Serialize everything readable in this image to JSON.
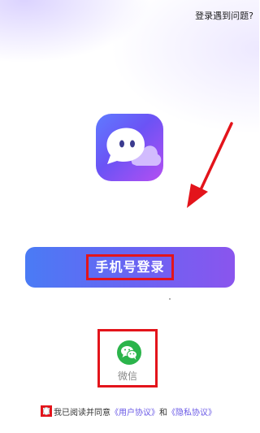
{
  "header": {
    "help_label": "登录遇到问题?"
  },
  "app": {
    "icon": "chat-bubble-app-icon"
  },
  "login": {
    "phone_label": "手机号登录"
  },
  "wechat": {
    "label": "微信",
    "icon": "wechat-icon"
  },
  "agreement": {
    "prefix": "我已阅读并同意",
    "user_agreement": "《用户协议》",
    "conjunction": "和",
    "privacy_policy": "《隐私协议》"
  },
  "colors": {
    "accent_blue": "#4a7bf5",
    "accent_purple": "#8a55ee",
    "wechat_green": "#2bb44b",
    "annotation_red": "#e3141b",
    "link": "#6a59e6"
  }
}
